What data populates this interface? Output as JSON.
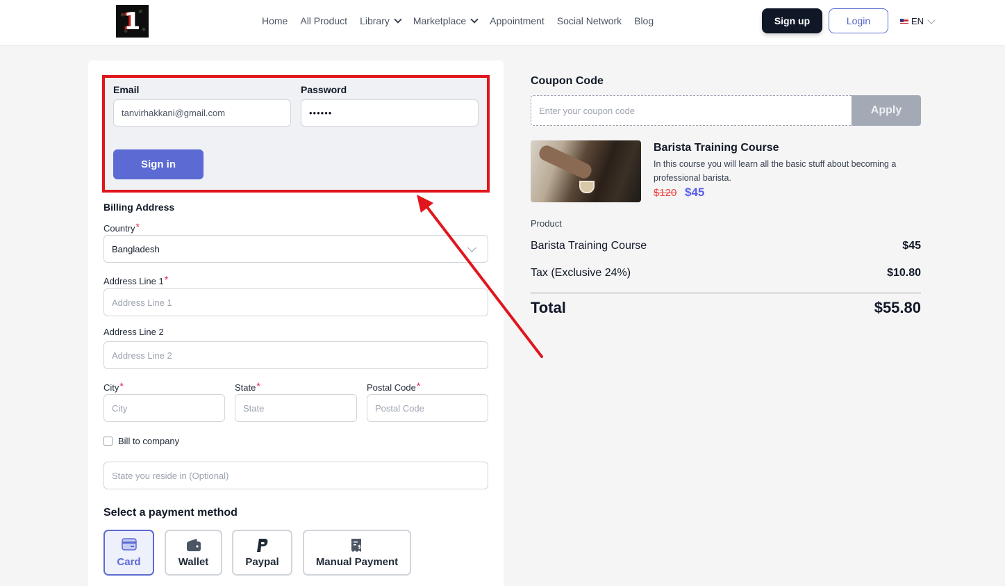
{
  "header": {
    "logo_text": "1",
    "nav": [
      "Home",
      "All Product",
      "Library",
      "Marketplace",
      "Appointment",
      "Social Network",
      "Blog"
    ],
    "signup_label": "Sign up",
    "login_label": "Login",
    "language": "EN"
  },
  "login": {
    "email_label": "Email",
    "email_value": "tanvirhakkani@gmail.com",
    "password_label": "Password",
    "password_value": "••••••",
    "signin_label": "Sign in"
  },
  "billing": {
    "title": "Billing Address",
    "country_label": "Country",
    "country_value": "Bangladesh",
    "address1_label": "Address Line 1",
    "address1_placeholder": "Address Line 1",
    "address2_label": "Address Line 2",
    "address2_placeholder": "Address Line 2",
    "city_label": "City",
    "city_placeholder": "City",
    "state_label": "State",
    "state_placeholder": "State",
    "postal_label": "Postal Code",
    "postal_placeholder": "Postal Code",
    "required_mark": "*",
    "bill_company_label": "Bill to company",
    "reside_placeholder": "State you reside in (Optional)"
  },
  "payment": {
    "title": "Select a payment method",
    "methods": [
      {
        "label": "Card",
        "icon": "card-icon",
        "selected": true
      },
      {
        "label": "Wallet",
        "icon": "wallet-icon",
        "selected": false
      },
      {
        "label": "Paypal",
        "icon": "paypal-icon",
        "selected": false
      },
      {
        "label": "Manual Payment",
        "icon": "receipt-icon",
        "selected": false
      }
    ]
  },
  "coupon": {
    "title": "Coupon Code",
    "placeholder": "Enter your coupon code",
    "apply_label": "Apply"
  },
  "course": {
    "title": "Barista Training Course",
    "description": "In this course you will learn all the basic stuff about becoming a professional barista.",
    "price_old": "$120",
    "price_new": "$45"
  },
  "summary": {
    "product_label": "Product",
    "item_name": "Barista Training Course",
    "item_price": "$45",
    "tax_label": "Tax (Exclusive 24%)",
    "tax_value": "$10.80",
    "total_label": "Total",
    "total_value": "$55.80"
  },
  "colors": {
    "accent": "#5b6bd3",
    "highlight_box": "#e0161c",
    "annotation_arrow": "#e0161c",
    "price_new": "#5b5fe6",
    "price_old": "#ef4444"
  }
}
